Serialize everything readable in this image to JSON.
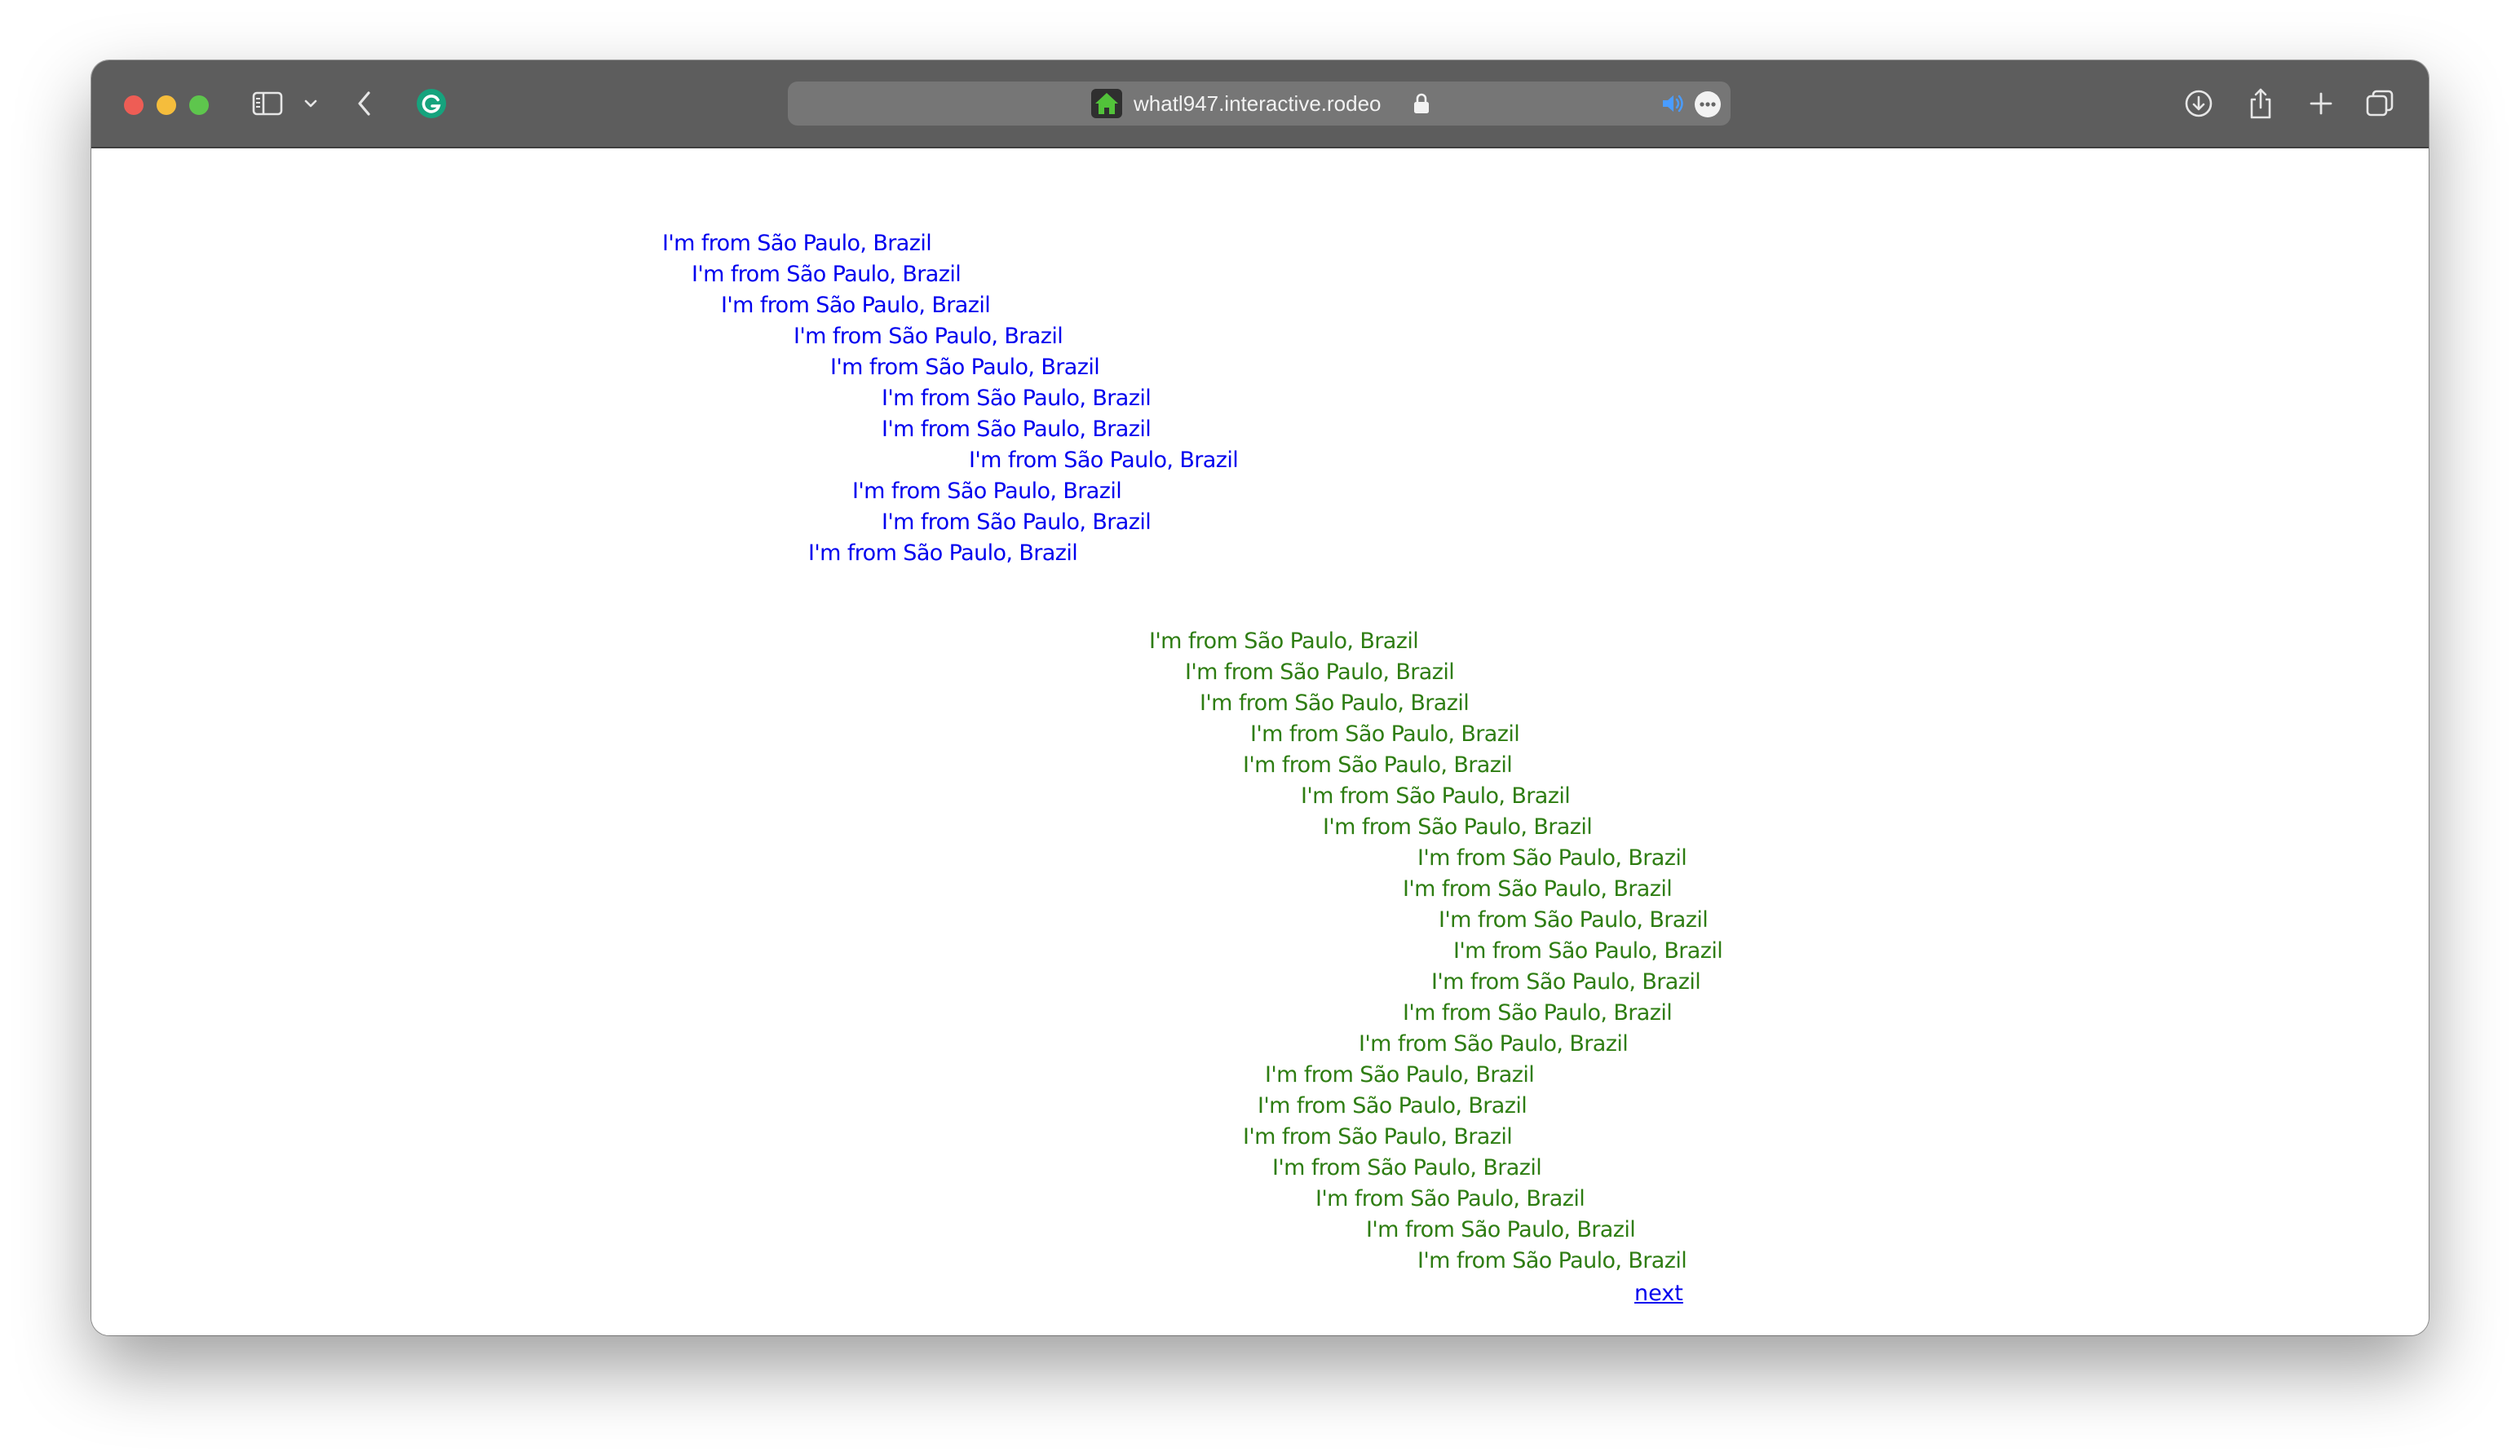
{
  "browser": {
    "url": "whatl947.interactive.rodeo",
    "icons": {
      "sidebar": "sidebar-icon",
      "chevron": "chevron-down-icon",
      "back": "back-arrow-icon",
      "extension": "grammarly-icon",
      "home": "home-icon",
      "lock": "lock-icon",
      "audio": "speaker-icon",
      "more": "ellipsis-icon",
      "download": "download-icon",
      "share": "share-icon",
      "new_tab": "plus-icon",
      "tabs": "tab-overview-icon"
    },
    "colors": {
      "toolbar": "#5d5d5d",
      "address_bar": "#767676",
      "close": "#ee5d55",
      "minimize": "#f5bd3c",
      "maximize": "#5ec64d"
    }
  },
  "page": {
    "colors": {
      "first_block": "#0000ee",
      "second_block": "#2e7d12",
      "link": "#0000ee"
    },
    "blue_lines": [
      "I'm from São Paulo, Brazil",
      "I'm from São Paulo, Brazil",
      "I'm from São Paulo, Brazil",
      "I'm from São Paulo, Brazil",
      "I'm from São Paulo, Brazil",
      "I'm from São Paulo, Brazil",
      "I'm from São Paulo, Brazil",
      "I'm from São Paulo, Brazil",
      "I'm from São Paulo, Brazil",
      "I'm from São Paulo, Brazil",
      "I'm from São Paulo, Brazil"
    ],
    "green_lines": [
      "I'm from São Paulo, Brazil",
      "I'm from São Paulo, Brazil",
      "I'm from São Paulo, Brazil",
      "I'm from São Paulo, Brazil",
      "I'm from São Paulo, Brazil",
      "I'm from São Paulo, Brazil",
      "I'm from São Paulo, Brazil",
      "I'm from São Paulo, Brazil",
      "I'm from São Paulo, Brazil",
      "I'm from São Paulo, Brazil",
      "I'm from São Paulo, Brazil",
      "I'm from São Paulo, Brazil",
      "I'm from São Paulo, Brazil",
      "I'm from São Paulo, Brazil",
      "I'm from São Paulo, Brazil",
      "I'm from São Paulo, Brazil",
      "I'm from São Paulo, Brazil",
      "I'm from São Paulo, Brazil",
      "I'm from São Paulo, Brazil",
      "I'm from São Paulo, Brazil",
      "I'm from São Paulo, Brazil"
    ],
    "next_label": "next"
  }
}
